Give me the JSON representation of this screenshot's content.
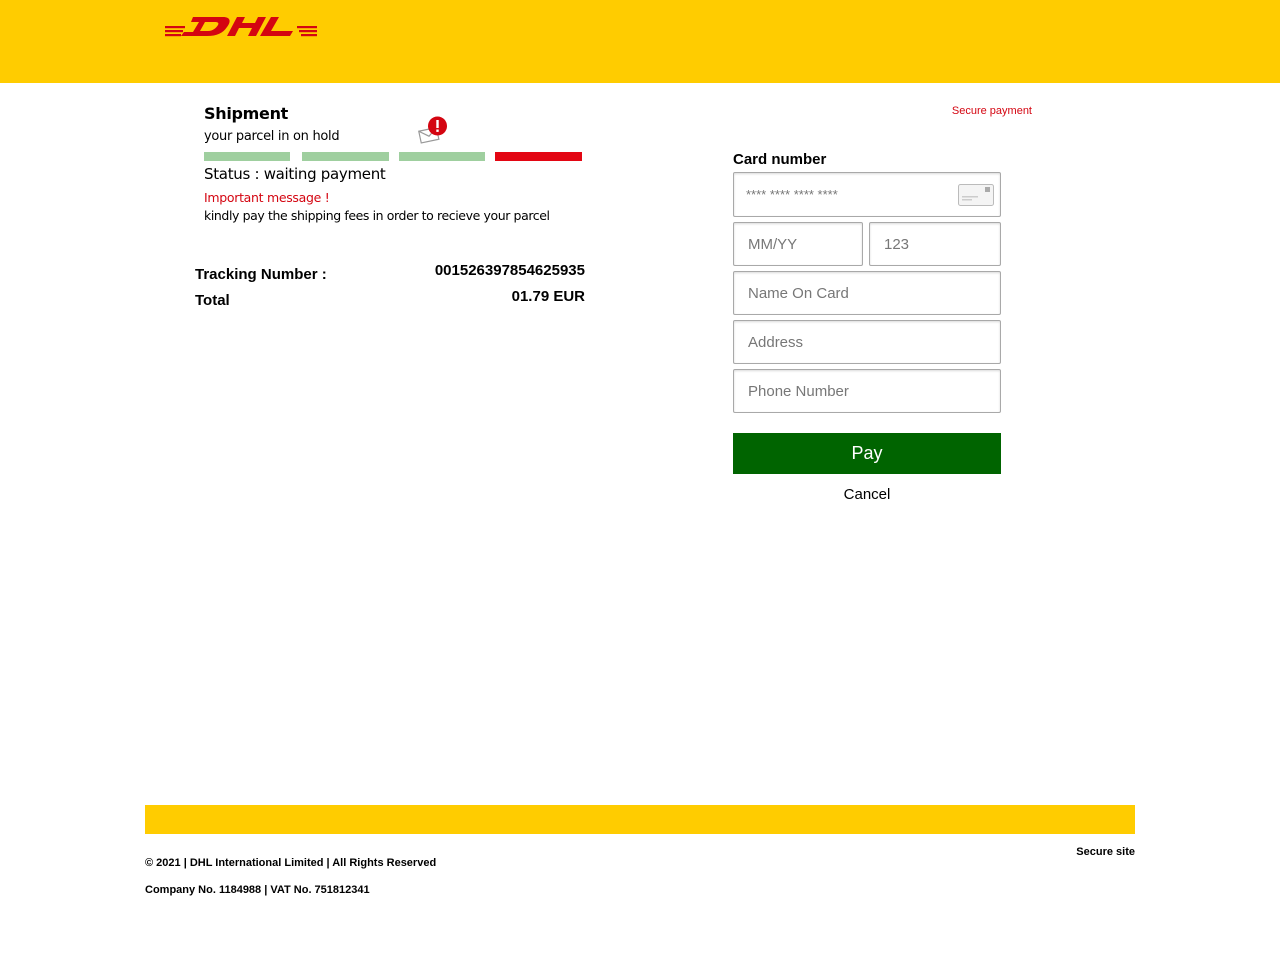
{
  "brand": {
    "name": "DHL",
    "yellow": "#FFCC00",
    "red": "#d40511",
    "green": "#006400"
  },
  "shipment": {
    "title": "Shipment",
    "subtitle": "your parcel in on hold",
    "status": "Status : waiting payment",
    "important": "Important message !",
    "message": "kindly pay the shipping fees in order to recieve your parcel",
    "progress_steps_completed": 3,
    "progress_steps_total": 4
  },
  "summary": {
    "tracking_label": "Tracking Number :",
    "tracking_value": "001526397854625935",
    "total_label": "Total",
    "total_value": "01.79 EUR"
  },
  "form": {
    "secure_payment": "Secure payment",
    "card_number_label": "Card number",
    "card_placeholder": "**** **** **** ****",
    "expiry_placeholder": "MM/YY",
    "cvv_placeholder": "123",
    "name_placeholder": "Name On Card",
    "address_placeholder": "Address",
    "phone_placeholder": "Phone Number",
    "pay_label": "Pay",
    "cancel_label": "Cancel"
  },
  "footer": {
    "secure_site": "Secure site",
    "copyright": "© 2021 | DHL International Limited | All Rights Reserved",
    "company": "Company No. 1184988 | VAT No. 751812341"
  }
}
